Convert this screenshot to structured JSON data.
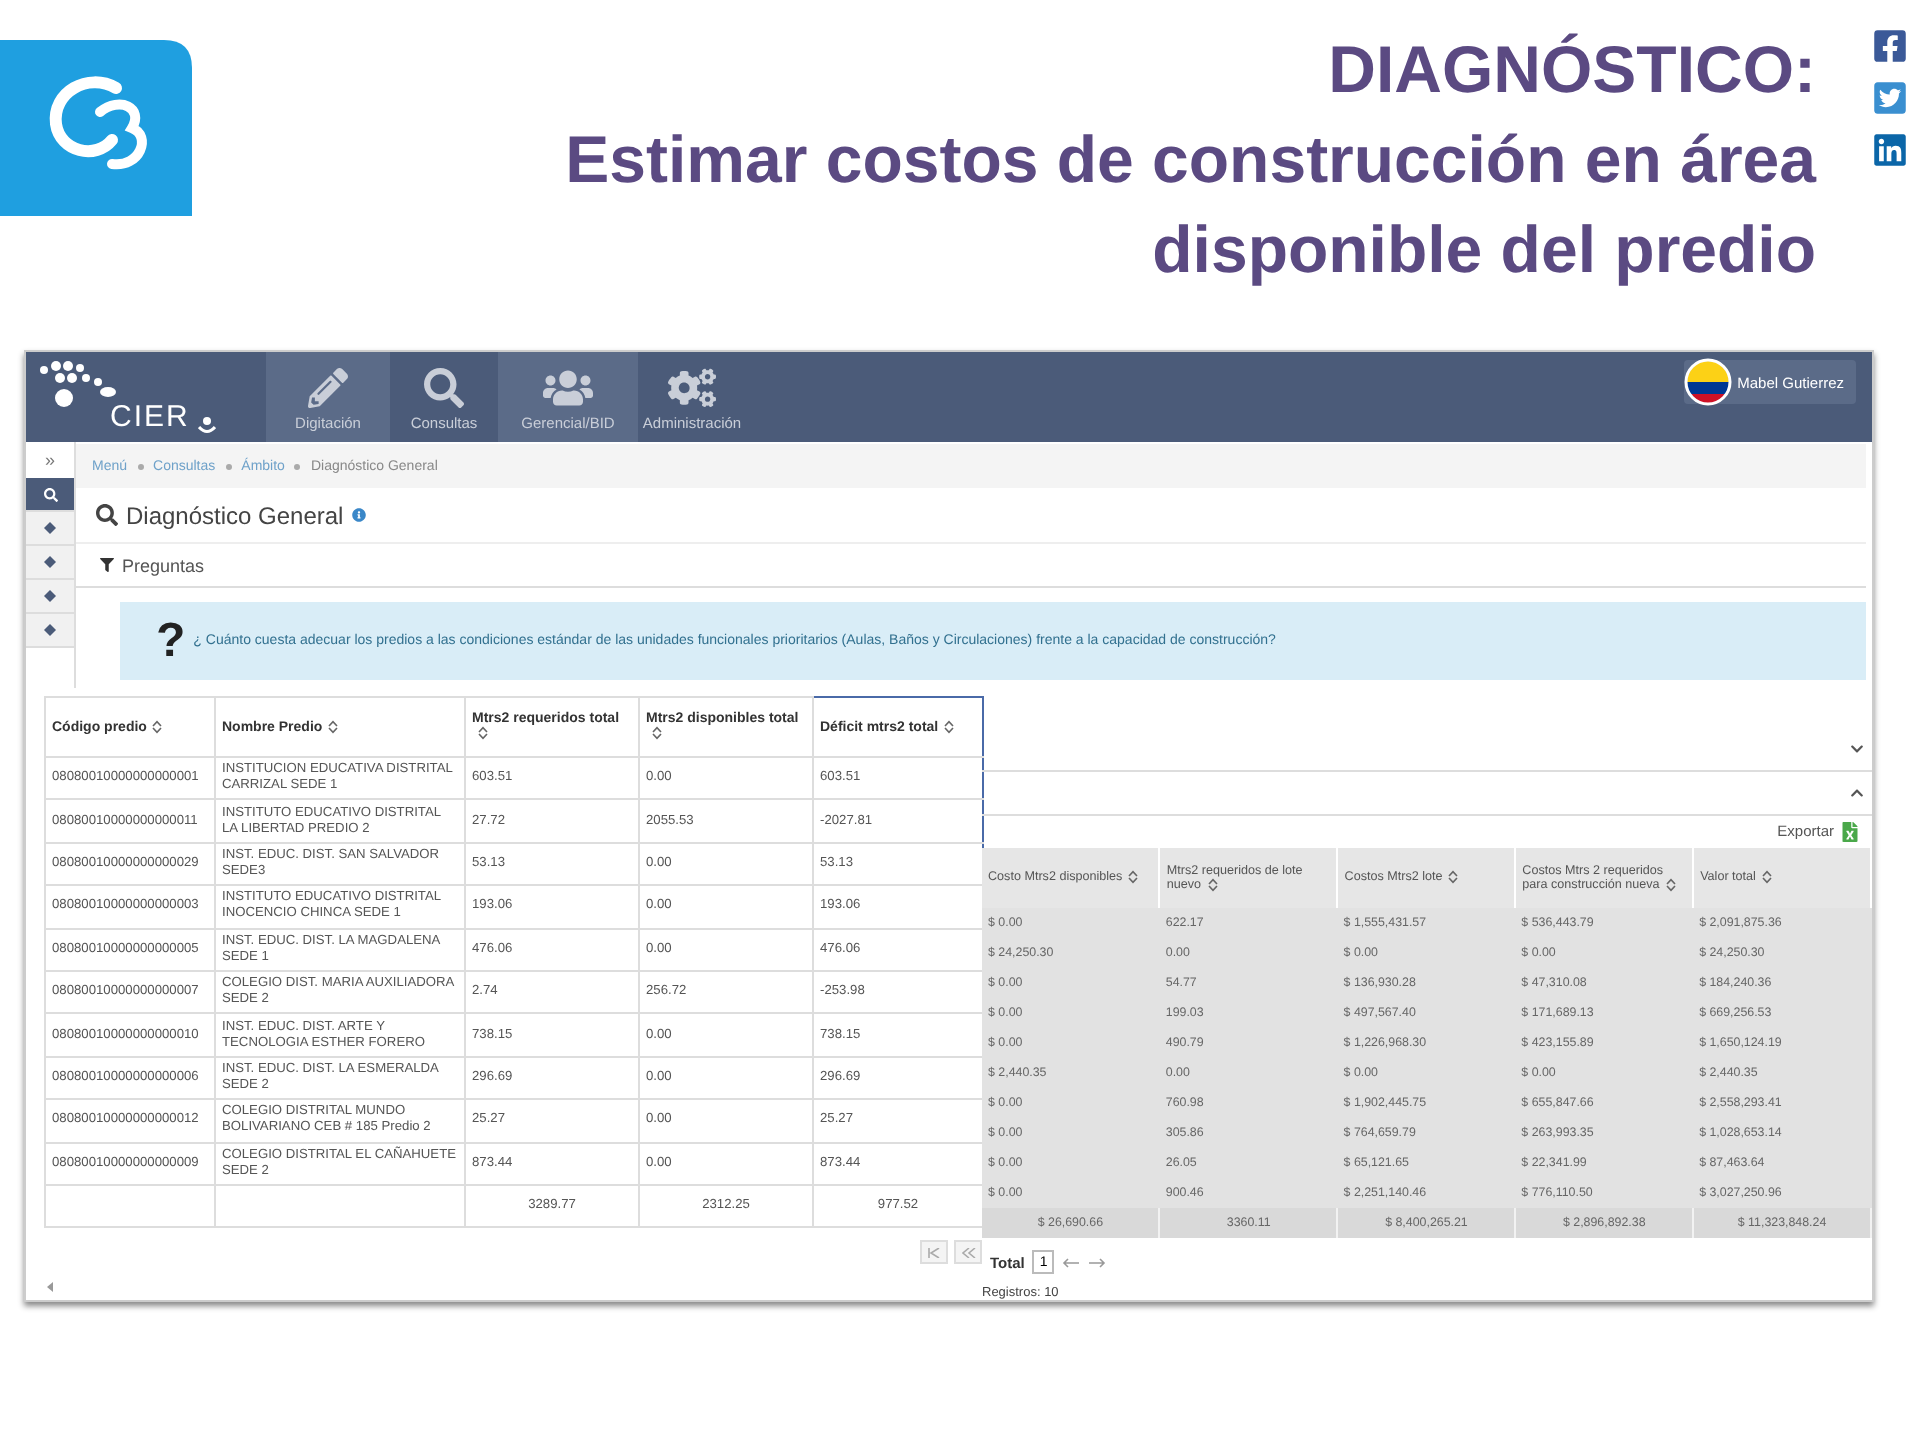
{
  "slide": {
    "title_lines": [
      "DIAGNÓSTICO:",
      "Estimar costos de construcción  en área",
      "disponible del predio"
    ]
  },
  "app": {
    "logo_text": "CIER",
    "nav": [
      {
        "label": "Digitación",
        "kind": "pencil"
      },
      {
        "label": "Consultas",
        "kind": "search"
      },
      {
        "label": "Gerencial/BID",
        "kind": "users"
      },
      {
        "label": "Administración",
        "kind": "cogs"
      }
    ],
    "user": "Mabel Gutierrez",
    "sidebar_toggle": "»",
    "sidebar": [
      {
        "kind": "search",
        "selected": true
      },
      {
        "kind": "dot",
        "selected": false
      },
      {
        "kind": "dot",
        "selected": false
      },
      {
        "kind": "dot",
        "selected": false
      },
      {
        "kind": "dot",
        "selected": false
      }
    ],
    "breadcrumb": [
      "Menú",
      "Consultas",
      "Ámbito",
      "Diagnóstico General"
    ],
    "page_title": "Diagnóstico General",
    "section": "Preguntas",
    "question_mark": "?",
    "question": "¿ Cuánto cuesta adecuar los predios a las condiciones estándar de las unidades funcionales prioritarios (Aulas, Baños y Circulaciones) frente a la capacidad de construcción?"
  },
  "left_table": {
    "columns": [
      {
        "label": "Código predio",
        "highlighted": false
      },
      {
        "label": "Nombre Predio",
        "highlighted": false
      },
      {
        "label": "Mtrs2 requeridos total",
        "highlighted": false
      },
      {
        "label": "Mtrs2 disponibles total",
        "highlighted": false
      },
      {
        "label": "Déficit mtrs2 total",
        "highlighted": true
      }
    ],
    "rows": [
      [
        "08080010000000000001",
        "INSTITUCION EDUCATIVA DISTRITAL CARRIZAL SEDE 1",
        "603.51",
        "0.00",
        "603.51"
      ],
      [
        "08080010000000000011",
        "INSTITUTO EDUCATIVO DISTRITAL LA LIBERTAD PREDIO 2",
        "27.72",
        "2055.53",
        "-2027.81"
      ],
      [
        "08080010000000000029",
        "INST. EDUC. DIST. SAN SALVADOR SEDE3",
        "53.13",
        "0.00",
        "53.13"
      ],
      [
        "08080010000000000003",
        "INSTITUTO EDUCATIVO DISTRITAL INOCENCIO CHINCA SEDE 1",
        "193.06",
        "0.00",
        "193.06"
      ],
      [
        "08080010000000000005",
        "INST. EDUC. DIST. LA MAGDALENA SEDE 1",
        "476.06",
        "0.00",
        "476.06"
      ],
      [
        "08080010000000000007",
        "COLEGIO DIST. MARIA AUXILIADORA SEDE 2",
        "2.74",
        "256.72",
        "-253.98"
      ],
      [
        "08080010000000000010",
        "INST. EDUC. DIST. ARTE Y TECNOLOGIA ESTHER FORERO",
        "738.15",
        "0.00",
        "738.15"
      ],
      [
        "08080010000000000006",
        "INST. EDUC. DIST. LA ESMERALDA SEDE 2",
        "296.69",
        "0.00",
        "296.69"
      ],
      [
        "08080010000000000012",
        "COLEGIO DISTRITAL MUNDO BOLIVARIANO CEB # 185 Predio 2",
        "25.27",
        "0.00",
        "25.27"
      ],
      [
        "08080010000000000009",
        "COLEGIO DISTRITAL EL CAÑAHUETE SEDE 2",
        "873.44",
        "0.00",
        "873.44"
      ]
    ],
    "totals": [
      "3289.77",
      "2312.25",
      "977.52"
    ]
  },
  "right_table": {
    "export_label": "Exportar",
    "columns": [
      "Costo Mtrs2 disponibles",
      "Mtrs2 requeridos de lote nuevo",
      "Costos Mtrs2 lote",
      "Costos Mtrs 2 requeridos para construcción nueva",
      "Valor total"
    ],
    "rows": [
      [
        "$ 0.00",
        "622.17",
        "$ 1,555,431.57",
        "$ 536,443.79",
        "$ 2,091,875.36"
      ],
      [
        "$ 24,250.30",
        "0.00",
        "$ 0.00",
        "$ 0.00",
        "$ 24,250.30"
      ],
      [
        "$ 0.00",
        "54.77",
        "$ 136,930.28",
        "$ 47,310.08",
        "$ 184,240.36"
      ],
      [
        "$ 0.00",
        "199.03",
        "$ 497,567.40",
        "$ 171,689.13",
        "$ 669,256.53"
      ],
      [
        "$ 0.00",
        "490.79",
        "$ 1,226,968.30",
        "$ 423,155.89",
        "$ 1,650,124.19"
      ],
      [
        "$ 2,440.35",
        "0.00",
        "$ 0.00",
        "$ 0.00",
        "$ 2,440.35"
      ],
      [
        "$ 0.00",
        "760.98",
        "$ 1,902,445.75",
        "$ 655,847.66",
        "$ 2,558,293.41"
      ],
      [
        "$ 0.00",
        "305.86",
        "$ 764,659.79",
        "$ 263,993.35",
        "$ 1,028,653.14"
      ],
      [
        "$ 0.00",
        "26.05",
        "$ 65,121.65",
        "$ 22,341.99",
        "$ 87,463.64"
      ],
      [
        "$ 0.00",
        "900.46",
        "$ 2,251,140.46",
        "$ 776,110.50",
        "$ 3,027,250.96"
      ]
    ],
    "totals": [
      "$ 26,690.66",
      "3360.11",
      "$ 8,400,265.21",
      "$ 2,896,892.38",
      "$ 11,323,848.24"
    ]
  },
  "pagination": {
    "total_label": "Total",
    "page": "1",
    "records": "Registros: 10"
  }
}
